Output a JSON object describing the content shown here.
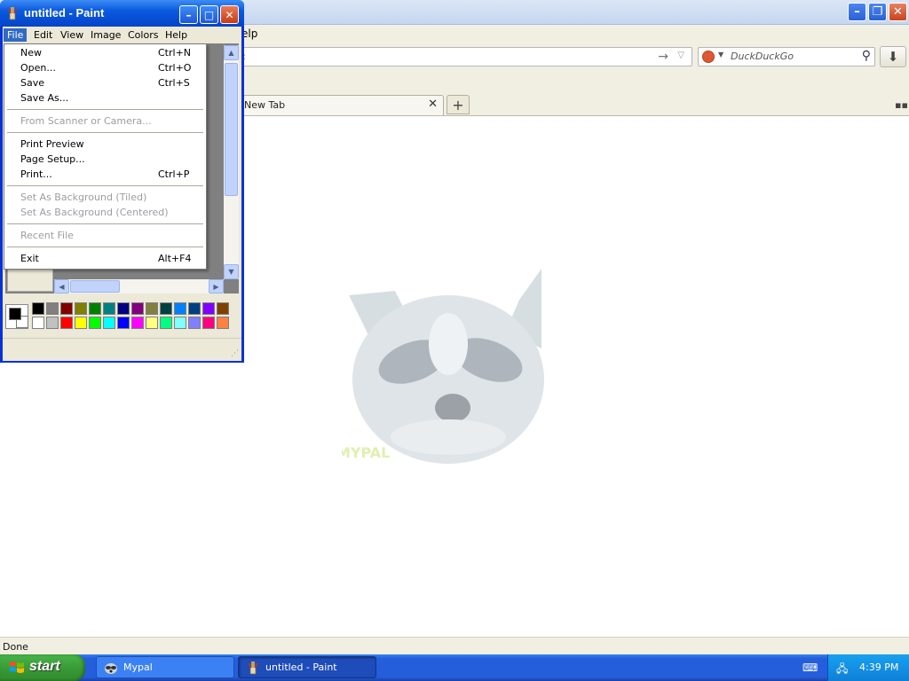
{
  "browser": {
    "menu_help_partial": "elp",
    "url": {
      "value": ":"
    },
    "search": {
      "placeholder": "DuckDuckGo"
    },
    "tab": {
      "label": "New Tab"
    },
    "status": "Done"
  },
  "paint": {
    "title": "untitled - Paint",
    "menus": [
      "File",
      "Edit",
      "View",
      "Image",
      "Colors",
      "Help"
    ],
    "palette_top": [
      "#000000",
      "#808080",
      "#800000",
      "#808000",
      "#008000",
      "#008080",
      "#000080",
      "#800080",
      "#808040",
      "#004040",
      "#0080ff",
      "#004080",
      "#8000ff",
      "#804000"
    ],
    "palette_bottom": [
      "#ffffff",
      "#c0c0c0",
      "#ff0000",
      "#ffff00",
      "#00ff00",
      "#00ffff",
      "#0000ff",
      "#ff00ff",
      "#ffff80",
      "#00ff80",
      "#80ffff",
      "#8080ff",
      "#ff0080",
      "#ff8040"
    ],
    "file_menu": {
      "new": {
        "label": "New",
        "shortcut": "Ctrl+N"
      },
      "open": {
        "label": "Open...",
        "shortcut": "Ctrl+O"
      },
      "save": {
        "label": "Save",
        "shortcut": "Ctrl+S"
      },
      "save_as": {
        "label": "Save As..."
      },
      "from_scanner": {
        "label": "From Scanner or Camera..."
      },
      "print_preview": {
        "label": "Print Preview"
      },
      "page_setup": {
        "label": "Page Setup..."
      },
      "print": {
        "label": "Print...",
        "shortcut": "Ctrl+P"
      },
      "bg_tiled": {
        "label": "Set As Background (Tiled)"
      },
      "bg_centered": {
        "label": "Set As Background (Centered)"
      },
      "recent": {
        "label": "Recent File"
      },
      "exit": {
        "label": "Exit",
        "shortcut": "Alt+F4"
      }
    }
  },
  "taskbar": {
    "start": "start",
    "tasks": [
      "Mypal",
      "untitled - Paint"
    ],
    "clock": "4:39 PM"
  }
}
